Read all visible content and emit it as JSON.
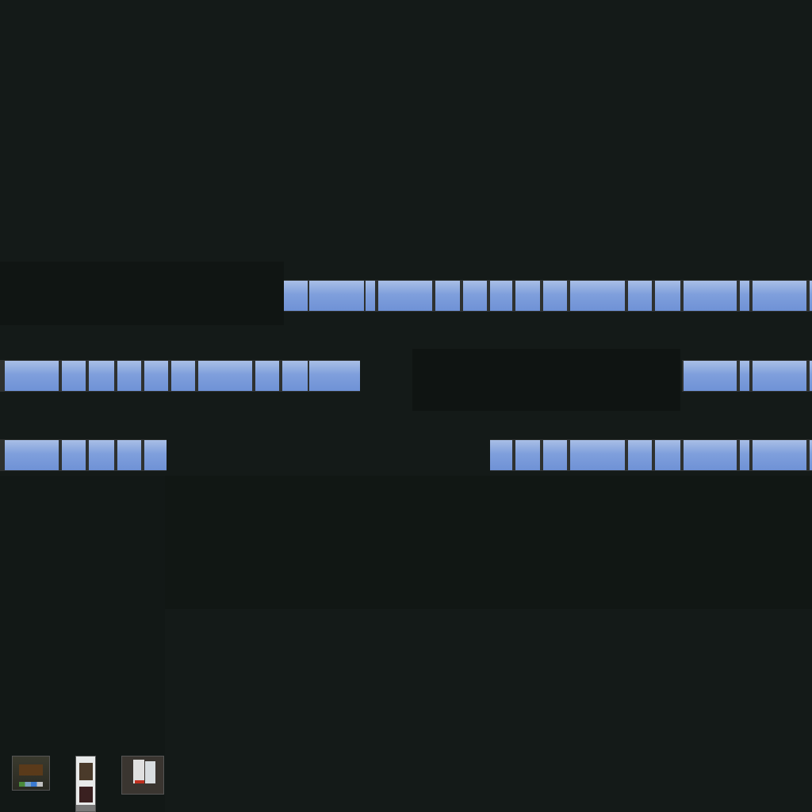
{
  "scene": {
    "background_color": "#141a18",
    "sky_color": "#7f9fdc",
    "mullion_color": "#2e3130",
    "window_rows": [
      "upper",
      "middle",
      "lower"
    ]
  },
  "thumbnails": [
    {
      "label": "shopfront-window"
    },
    {
      "label": "glass-door"
    },
    {
      "label": "poster-window"
    }
  ]
}
